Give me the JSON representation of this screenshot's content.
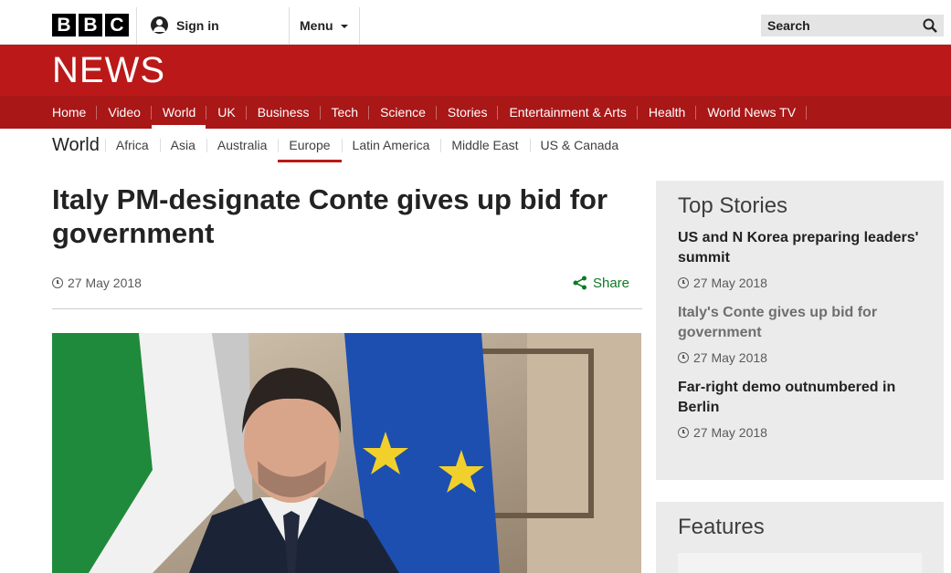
{
  "header": {
    "logo_letters": [
      "B",
      "B",
      "C"
    ],
    "signin_label": "Sign in",
    "menu_label": "Menu",
    "search_placeholder": "Search"
  },
  "brand": {
    "name": "NEWS",
    "color": "#bb1919"
  },
  "main_nav": {
    "items": [
      "Home",
      "Video",
      "World",
      "UK",
      "Business",
      "Tech",
      "Science",
      "Stories",
      "Entertainment & Arts",
      "Health",
      "World News TV"
    ],
    "active": "World"
  },
  "sub_nav": {
    "title": "World",
    "items": [
      "Africa",
      "Asia",
      "Australia",
      "Europe",
      "Latin America",
      "Middle East",
      "US & Canada"
    ],
    "active": "Europe"
  },
  "article": {
    "headline": "Italy PM-designate Conte gives up bid for government",
    "date": "27 May 2018",
    "share_label": "Share"
  },
  "top_stories": {
    "title": "Top Stories",
    "items": [
      {
        "headline": "US and N Korea preparing leaders' summit",
        "date": "27 May 2018"
      },
      {
        "headline": "Italy's Conte gives up bid for government",
        "date": "27 May 2018"
      },
      {
        "headline": "Far-right demo outnumbered in Berlin",
        "date": "27 May 2018"
      }
    ]
  },
  "features": {
    "title": "Features"
  },
  "colors": {
    "accent_red": "#bb1919",
    "nav_red": "#a91717",
    "share_green": "#0c7a24"
  }
}
